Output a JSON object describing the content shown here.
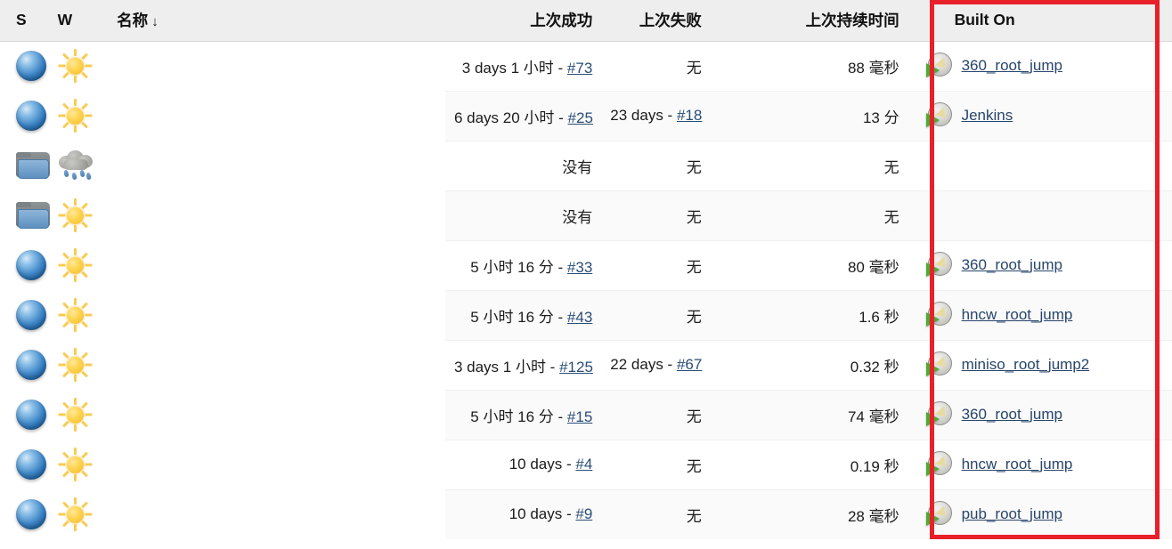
{
  "table": {
    "columns": [
      {
        "key": "status",
        "label": "S",
        "icon": "status-ball-icon"
      },
      {
        "key": "weather",
        "label": "W",
        "icon": "weather-icon"
      },
      {
        "key": "name",
        "label": "名称",
        "sort_arrow": "↓"
      },
      {
        "key": "last_success",
        "label": "上次成功"
      },
      {
        "key": "last_failure",
        "label": "上次失败"
      },
      {
        "key": "last_duration",
        "label": "上次持续时间"
      },
      {
        "key": "built_on",
        "label": "Built On"
      }
    ],
    "rows": [
      {
        "status_icon": "blue-ball-icon",
        "weather_icon": "sunny-icon",
        "name": "",
        "last_success": "3 days 1 小时 - ",
        "last_success_build": "#73",
        "last_failure": "无",
        "last_failure_build": "",
        "last_duration": "88 毫秒",
        "built_on": "360_root_jump",
        "built_on_icon": "computer-node-icon"
      },
      {
        "status_icon": "blue-ball-icon",
        "weather_icon": "sunny-icon",
        "name": "",
        "last_success": "6 days 20 小时 - ",
        "last_success_build": "#25",
        "last_failure": "23 days - ",
        "last_failure_build": "#18",
        "last_duration": "13 分",
        "built_on": "Jenkins",
        "built_on_icon": "computer-node-icon"
      },
      {
        "status_icon": "folder-icon",
        "weather_icon": "storm-icon",
        "name": "",
        "last_success": "没有",
        "last_success_build": "",
        "last_failure": "无",
        "last_failure_build": "",
        "last_duration": "无",
        "built_on": "",
        "built_on_icon": ""
      },
      {
        "status_icon": "folder-icon",
        "weather_icon": "sunny-icon",
        "name": "",
        "last_success": "没有",
        "last_success_build": "",
        "last_failure": "无",
        "last_failure_build": "",
        "last_duration": "无",
        "built_on": "",
        "built_on_icon": ""
      },
      {
        "status_icon": "blue-ball-icon",
        "weather_icon": "sunny-icon",
        "name": "",
        "last_success": "5 小时 16 分 - ",
        "last_success_build": "#33",
        "last_failure": "无",
        "last_failure_build": "",
        "last_duration": "80 毫秒",
        "built_on": "360_root_jump",
        "built_on_icon": "computer-node-icon"
      },
      {
        "status_icon": "blue-ball-icon",
        "weather_icon": "sunny-icon",
        "name": "",
        "last_success": "5 小时 16 分 - ",
        "last_success_build": "#43",
        "last_failure": "无",
        "last_failure_build": "",
        "last_duration": "1.6 秒",
        "built_on": "hncw_root_jump",
        "built_on_icon": "computer-node-icon"
      },
      {
        "status_icon": "blue-ball-icon",
        "weather_icon": "sunny-icon",
        "name": "",
        "last_success": "3 days 1 小时 - ",
        "last_success_build": "#125",
        "last_failure": "22 days - ",
        "last_failure_build": "#67",
        "last_duration": "0.32 秒",
        "built_on": "miniso_root_jump2",
        "built_on_icon": "computer-node-icon"
      },
      {
        "status_icon": "blue-ball-icon",
        "weather_icon": "sunny-icon",
        "name": "",
        "last_success": "5 小时 16 分 - ",
        "last_success_build": "#15",
        "last_failure": "无",
        "last_failure_build": "",
        "last_duration": "74 毫秒",
        "built_on": "360_root_jump",
        "built_on_icon": "computer-node-icon"
      },
      {
        "status_icon": "blue-ball-icon",
        "weather_icon": "sunny-icon",
        "name": "",
        "last_success": "10 days - ",
        "last_success_build": "#4",
        "last_failure": "无",
        "last_failure_build": "",
        "last_duration": "0.19 秒",
        "built_on": "hncw_root_jump",
        "built_on_icon": "computer-node-icon"
      },
      {
        "status_icon": "blue-ball-icon",
        "weather_icon": "sunny-icon",
        "name": "",
        "last_success": "10 days - ",
        "last_success_build": "#9",
        "last_failure": "无",
        "last_failure_build": "",
        "last_duration": "28 毫秒",
        "built_on": "pub_root_jump",
        "built_on_icon": "computer-node-icon"
      }
    ]
  },
  "annotation": {
    "type": "highlight-rectangle",
    "target_column": "Built On",
    "color": "#e8202a"
  },
  "colors": {
    "header_bg": "#eeeeee",
    "row_bg": "#ffffff",
    "row_alt_bg": "#fafafa",
    "link": "#2a4d75",
    "text": "#1c1c1c",
    "highlight": "#e8202a"
  }
}
